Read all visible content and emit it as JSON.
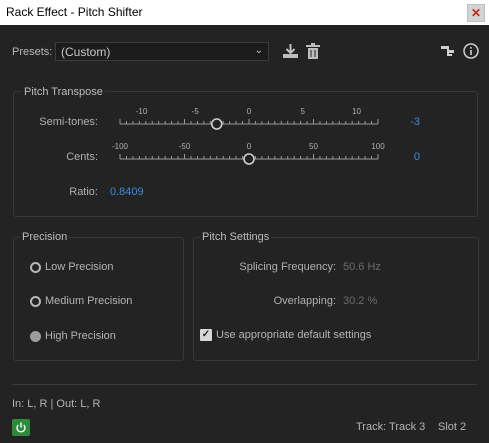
{
  "window": {
    "title": "Rack Effect - Pitch Shifter",
    "close_label": "✕"
  },
  "presets": {
    "label": "Presets:",
    "selected": "(Custom)"
  },
  "pitch_transpose": {
    "title": "Pitch Transpose",
    "semitones": {
      "label": "Semi-tones:",
      "ticks": [
        "-10",
        "-5",
        "0",
        "5",
        "10"
      ],
      "value": "-3",
      "numeric_value": -3,
      "min": -12,
      "max": 12
    },
    "cents": {
      "label": "Cents:",
      "ticks": [
        "-100",
        "-50",
        "0",
        "50",
        "100"
      ],
      "value": "0",
      "numeric_value": 0,
      "min": -100,
      "max": 100
    },
    "ratio": {
      "label": "Ratio:",
      "value": "0.8409"
    }
  },
  "precision": {
    "title": "Precision",
    "options": [
      "Low Precision",
      "Medium Precision",
      "High Precision"
    ],
    "selected_index": 2
  },
  "pitch_settings": {
    "title": "Pitch Settings",
    "splicing": {
      "label": "Splicing Frequency:",
      "value": "50.6 Hz"
    },
    "overlapping": {
      "label": "Overlapping:",
      "value": "30.2 %"
    },
    "use_defaults": {
      "label": "Use appropriate default settings",
      "checked": true
    }
  },
  "footer": {
    "io": "In: L, R | Out: L, R",
    "track": "Track: Track 3",
    "slot": "Slot 2"
  },
  "colors": {
    "accent_blue": "#3e8ae0",
    "power_green": "#2e8b3c",
    "background": "#232323"
  }
}
